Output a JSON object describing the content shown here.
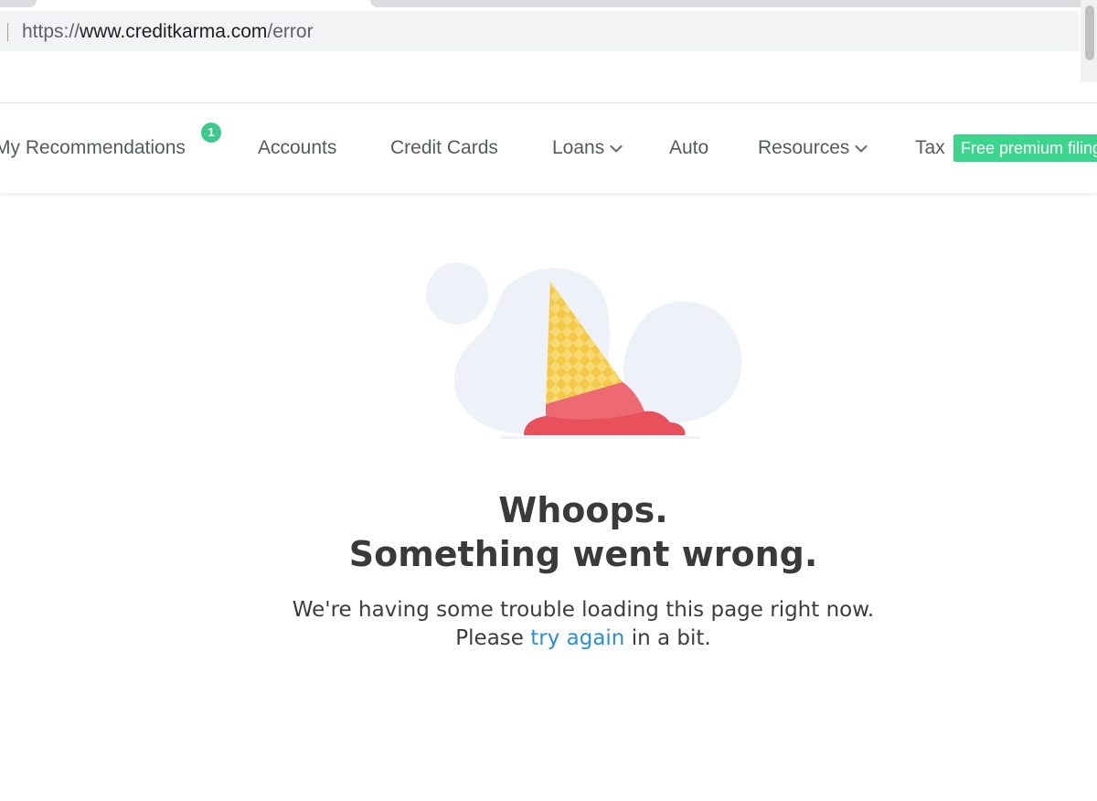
{
  "browser": {
    "url_scheme": "https://",
    "url_host": "www.creditkarma.com",
    "url_path": "/error"
  },
  "nav": {
    "items": [
      {
        "label": "My Recommendations",
        "badge": "1"
      },
      {
        "label": "Accounts"
      },
      {
        "label": "Credit Cards"
      },
      {
        "label": "Loans",
        "dropdown": true
      },
      {
        "label": "Auto"
      },
      {
        "label": "Resources",
        "dropdown": true
      },
      {
        "label": "Tax",
        "tag": "Free premium filing"
      }
    ]
  },
  "error": {
    "headline_line1": "Whoops.",
    "headline_line2": "Something went wrong.",
    "body_line1": "We're having some trouble loading this page right now.",
    "body_pre": "Please ",
    "body_link": "try again",
    "body_post": " in a bit."
  },
  "colors": {
    "badge": "#3cc98c",
    "tag": "#3cd58d",
    "link": "#2b8fd6",
    "cone": "#f6d15a",
    "ice_cream": "#e8505b"
  },
  "icons": {
    "dropdown": "chevron-down-icon",
    "illustration": "dropped-ice-cream-cone"
  }
}
